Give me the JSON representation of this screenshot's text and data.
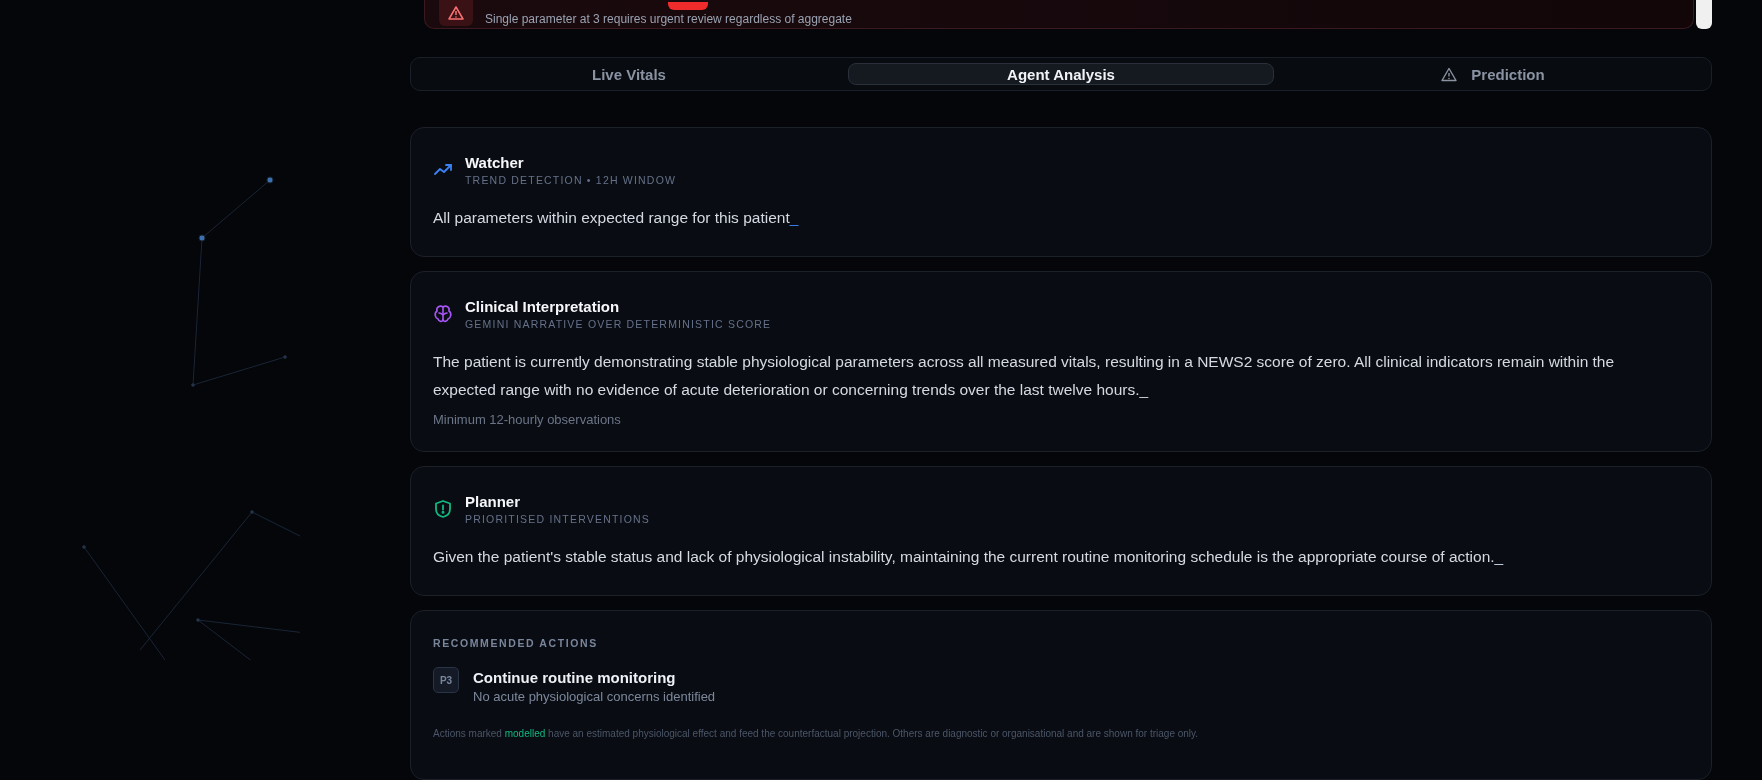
{
  "alert": {
    "note": "Single parameter at 3 requires urgent review regardless of aggregate"
  },
  "tabs": [
    {
      "label": "Live Vitals",
      "selected": false,
      "kind": "plain"
    },
    {
      "label": "Agent Analysis",
      "selected": true,
      "kind": "plain"
    },
    {
      "label": "Prediction",
      "selected": false,
      "kind": "warning"
    }
  ],
  "agents": [
    {
      "kind": "watcher",
      "title": "Watcher",
      "subtitle": "TREND DETECTION • 12H WINDOW",
      "text": "All parameters within expected range for this patient",
      "cursor": "_"
    },
    {
      "kind": "interpretation",
      "title": "Clinical Interpretation",
      "subtitle": "GEMINI NARRATIVE OVER DETERMINISTIC SCORE",
      "text": "The patient is currently demonstrating stable physiological parameters across all measured vitals, resulting in a NEWS2 score of zero. All clinical indicators remain within the expected range with no evidence of acute deterioration or concerning trends over the last twelve hours.",
      "cursor": "_",
      "note": "Minimum 12-hourly observations"
    },
    {
      "kind": "planner",
      "title": "Planner",
      "subtitle": "PRIORITISED INTERVENTIONS",
      "text": "Given the patient's stable status and lack of physiological instability, maintaining the current routine monitoring schedule is the appropriate course of action.",
      "cursor": "_"
    }
  ],
  "recommended": {
    "heading": "RECOMMENDED ACTIONS",
    "actions": [
      {
        "priority": "P3",
        "title": "Continue routine monitoring",
        "detail": "No acute physiological concerns identified"
      }
    ],
    "footnote": "Actions marked **modelled** have an estimated physiological effect and feed the counterfactual projection. Others are diagnostic or organisational and are shown for triage only."
  }
}
